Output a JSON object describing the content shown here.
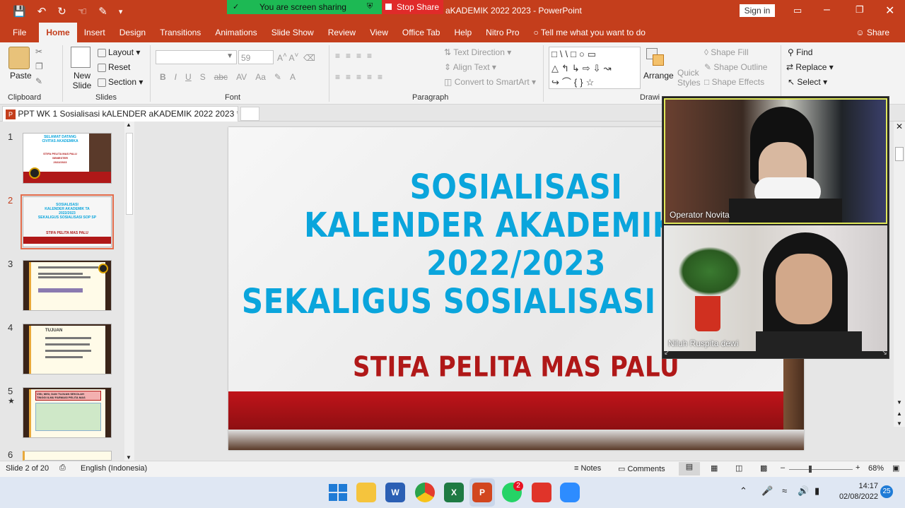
{
  "window": {
    "title_suffix": "aKADEMIK 2022 2023 - PowerPoint",
    "sign_in": "Sign in",
    "qat_icons": [
      "save-icon",
      "undo-icon",
      "redo-icon",
      "touch-icon",
      "customize-icon"
    ]
  },
  "share": {
    "banner": "You are screen sharing",
    "stop": "Stop Share"
  },
  "menu": {
    "file": "File",
    "tabs": [
      "Home",
      "Insert",
      "Design",
      "Transitions",
      "Animations",
      "Slide Show",
      "Review",
      "View",
      "Office Tab",
      "Help",
      "Nitro Pro"
    ],
    "tell_me": "Tell me what you want to do",
    "share": "Share"
  },
  "ribbon": {
    "clipboard": {
      "label": "Clipboard",
      "paste": "Paste"
    },
    "slides": {
      "label": "Slides",
      "new_slide": "New Slide",
      "layout": "Layout",
      "reset": "Reset",
      "section": "Section"
    },
    "font": {
      "label": "Font",
      "size": "59",
      "buttons": [
        "B",
        "I",
        "U",
        "S",
        "abc",
        "AV",
        "Aa",
        "A"
      ]
    },
    "paragraph": {
      "label": "Paragraph",
      "text_direction": "Text Direction",
      "align_text": "Align Text",
      "convert": "Convert to SmartArt"
    },
    "drawing": {
      "label": "Drawi",
      "arrange": "Arrange",
      "quick_styles": "Quick Styles",
      "shape_fill": "Shape Fill",
      "shape_outline": "Shape Outline",
      "shape_effects": "Shape Effects"
    },
    "editing": {
      "find": "Find",
      "replace": "Replace",
      "select": "Select"
    }
  },
  "doc_tab": {
    "name": "PPT WK 1 Sosialisasi kALENDER aKADEMIK 2022 2023 *"
  },
  "thumbnails": [
    {
      "num": "1",
      "star": "",
      "lines": [
        "SELAMAT DATANG",
        "CIVITAS AKADEMIKA",
        "STIFA PELITA MAS PALU",
        "SEMESTER",
        "2022/2023"
      ]
    },
    {
      "num": "2",
      "star": "",
      "lines": [
        "SOSIALISASI",
        "KALENDER AKADEMIK TA",
        "2022/2023",
        "SEKALIGUS SOSIALISASI SOP SP",
        "STIFA PELITA MAS PALU"
      ]
    },
    {
      "num": "3",
      "star": "",
      "lines": []
    },
    {
      "num": "4",
      "star": "",
      "lines": [
        "TUJUAN"
      ]
    },
    {
      "num": "5",
      "star": "★",
      "lines": [
        "VISI, MISI, DAN TUJUAN SEKOLAH",
        "TINGGI ILMU FARMASI PELITA MAS"
      ]
    },
    {
      "num": "6",
      "star": "",
      "lines": []
    }
  ],
  "slide": {
    "line1": "SOSIALISASI",
    "line2": "KALENDER AKADEMIK TA",
    "line3": "2022/2023",
    "line4": "SEKALIGUS SOSIALISASI SOP SP",
    "subtitle": "STIFA PELITA MAS PALU"
  },
  "video": {
    "participants": [
      {
        "name": "Operator Novita"
      },
      {
        "name": "Niluh Ruspita dewi"
      }
    ]
  },
  "status": {
    "slide_info": "Slide 2 of 20",
    "language": "English (Indonesia)",
    "notes": "Notes",
    "comments": "Comments",
    "zoom": "68%"
  },
  "taskbar": {
    "time": "14:17",
    "date": "02/08/2022",
    "whatsapp_badge": "2",
    "notif_count": "25"
  }
}
